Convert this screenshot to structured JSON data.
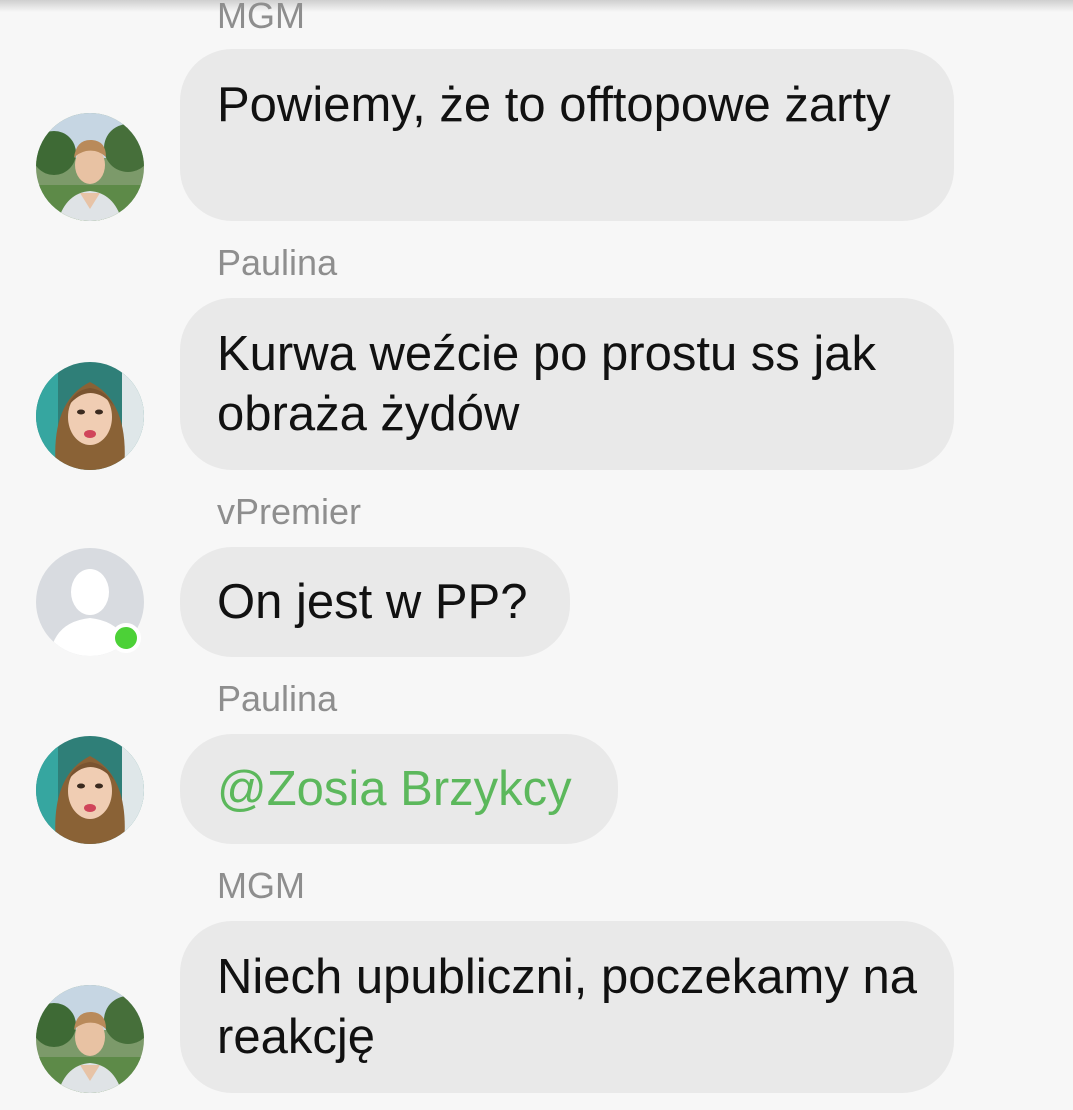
{
  "messages": [
    {
      "sender": "MGM",
      "text": "Powiemy, że to offtopowe żarty"
    },
    {
      "sender": "Paulina",
      "text": "Kurwa weźcie po prostu ss jak obraża żydów"
    },
    {
      "sender": "vPremier",
      "text": "On jest w PP?"
    },
    {
      "sender": "Paulina",
      "text": "@Zosia Brzykcy"
    },
    {
      "sender": "MGM",
      "text": "Niech upubliczni, poczekamy na reakcję"
    }
  ],
  "colors": {
    "background": "#f7f7f7",
    "bubble": "#e9e9e9",
    "sender_label": "#8e8e8e",
    "mention": "#5cb85c",
    "online": "#4cd137"
  },
  "icons": {
    "avatar_mgm": "user-photo-man",
    "avatar_paulina": "user-photo-woman",
    "avatar_vpremier": "default-user-silhouette-icon",
    "online": "online-status-dot"
  }
}
